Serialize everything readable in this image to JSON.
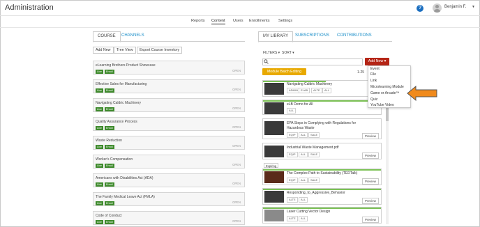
{
  "header": {
    "title": "Administration",
    "help_icon": "?",
    "user_name": "Benjamin F.",
    "user_caret": "▼"
  },
  "nav": {
    "items": [
      "Reports",
      "Content",
      "Users",
      "Enrollments",
      "Settings"
    ],
    "active": "Content"
  },
  "left_panel": {
    "tabs": [
      "COURSE",
      "CHANNELS"
    ],
    "buttons": [
      "Add New",
      "Tree View",
      "Export Course Inventory"
    ],
    "badge_live": "Live",
    "badge_enroll": "Enroll",
    "open_label": "OPEN",
    "courses": [
      "eLearning Brothers Product Showcase",
      "Effective Sales for Manufacturing",
      "Navigating Caldric Machinery",
      "Quality Assurance Process",
      "Waste Reduction",
      "Worker's Compensation",
      "Americans with Disabilities Act (ADA)",
      "The Family Medical Leave Act (FMLA)",
      "Code of Conduct"
    ]
  },
  "right_panel": {
    "tabs": [
      "MY LIBRARY",
      "SUBSCRIPTIONS",
      "CONTRIBUTIONS"
    ],
    "filters_label": "FILTERS ▾",
    "sort_label": "SORT ▾",
    "add_new_label": "Add New ▾",
    "batch_button": "Module Batch Editing",
    "paging": "1-25",
    "preview_label": "Preview",
    "expiring_label": "Expiring",
    "library_items": [
      {
        "title": "Navigating Caldric Machinery",
        "tags": [
          "ADMIN",
          "ELAB",
          "ALTE",
          "ALL"
        ]
      },
      {
        "title": "eLB Demo for All",
        "tags": [
          "ALL"
        ]
      },
      {
        "title": "EPA Steps in Complying with Regulations for Hazardous Waste",
        "tags": [
          "EQIP",
          "ALL",
          "SALE"
        ]
      },
      {
        "title": "Industrial Waste Management.pdf",
        "tags": [
          "EQIP",
          "ALL",
          "SALE"
        ]
      },
      {
        "title": "The Complex Path to Sustainability (TEDTalk)",
        "tags": [
          "EQIP",
          "ALL",
          "SALE"
        ]
      },
      {
        "title": "Responding_to_Aggressive_Behavior",
        "tags": [
          "ALTE",
          "ALL"
        ]
      },
      {
        "title": "Laser Cutting Vector Design",
        "tags": [
          "ALTE",
          "ALL"
        ]
      }
    ],
    "dropdown": [
      "Event",
      "File",
      "Link",
      "Microlearning Module",
      "Game or Arcade™",
      "Quiz",
      "YouTube Video"
    ],
    "colors": {
      "add_new": "#b52516",
      "batch": "#e8a900",
      "accent_link": "#1c8fc9",
      "live_badge": "#3f8b2d",
      "arrow": "#f08a1c"
    }
  }
}
